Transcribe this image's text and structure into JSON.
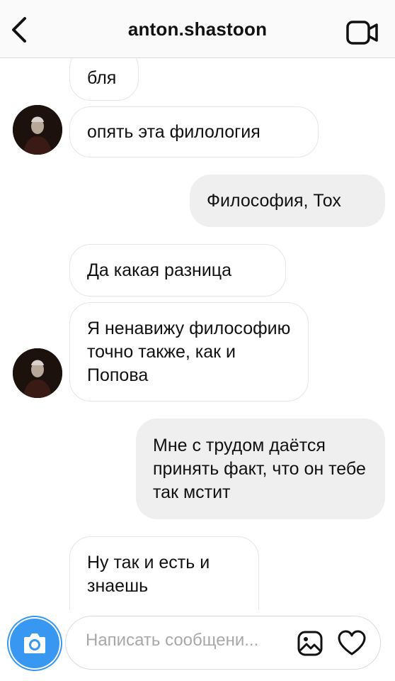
{
  "header": {
    "title": "anton.shastoon",
    "back_icon": "chevron-left-icon",
    "video_icon": "video-camera-icon"
  },
  "messages": [
    {
      "side": "in",
      "text": "бля"
    },
    {
      "side": "in",
      "text": "опять эта филология"
    },
    {
      "side": "out",
      "text": "Философия, Тох"
    },
    {
      "side": "in",
      "text": "Да какая разница"
    },
    {
      "side": "in",
      "text": "Я ненавижу философию точно также, как и Попова"
    },
    {
      "side": "out",
      "text": "Мне с трудом даётся принять факт, что он тебе так мстит"
    },
    {
      "side": "in",
      "text": "Ну так и есть и знаешь"
    }
  ],
  "composer": {
    "placeholder": "Написать сообщени...",
    "camera_icon": "camera-icon",
    "gallery_icon": "gallery-icon",
    "heart_icon": "heart-icon"
  },
  "colors": {
    "accent": "#3897f0",
    "incoming_border": "#e6e6e6",
    "outgoing_bg": "#efefef"
  }
}
